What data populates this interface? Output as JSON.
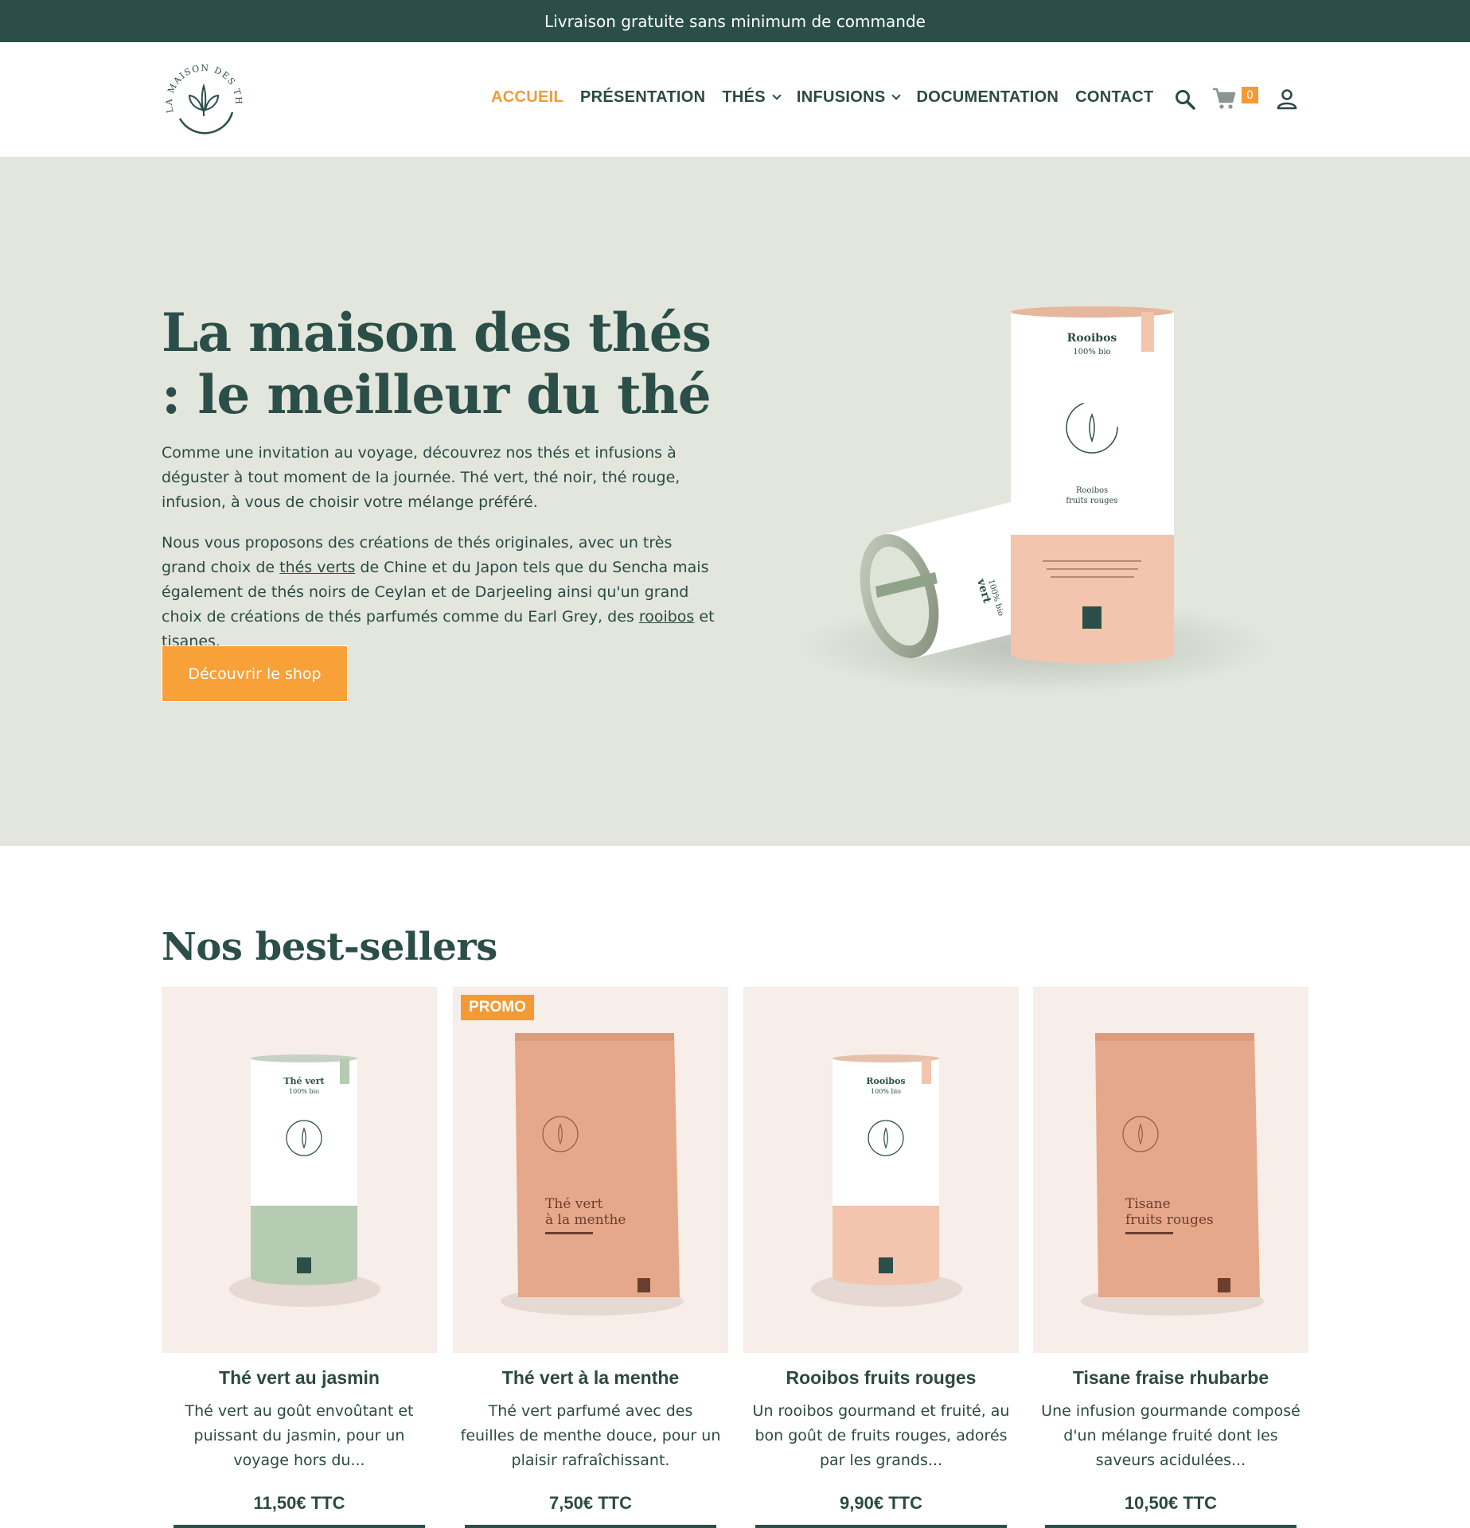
{
  "topbar": {
    "text": "Livraison gratuite sans minimum de commande"
  },
  "header": {
    "logo_text": "LA MAISON DES THÉS",
    "nav": [
      {
        "label": "ACCUEIL",
        "active": true
      },
      {
        "label": "PRÉSENTATION"
      },
      {
        "label": "THÉS",
        "has_dropdown": true
      },
      {
        "label": "INFUSIONS",
        "has_dropdown": true
      },
      {
        "label": "DOCUMENTATION"
      },
      {
        "label": "CONTACT"
      }
    ],
    "cart_count": "0",
    "icons": [
      "search-icon",
      "cart-icon",
      "user-icon"
    ]
  },
  "hero": {
    "title": "La maison des thés : le meilleur du thé",
    "paragraph1": "Comme une invitation au voyage, découvrez nos thés et infusions à déguster à tout moment de la journée. Thé vert, thé noir, thé rouge, infusion, à vous de choisir votre mélange préféré.",
    "paragraph2": {
      "before_link1": "Nous vous proposons des créations de thés originales, avec un très grand choix de ",
      "link1": "thés verts",
      "between": " de Chine et du Japon tels que du Sencha mais également de thés noirs de Ceylan et de Darjeeling ainsi qu'un grand choix de créations de thés parfumés comme du Earl Grey, des ",
      "link2": "rooibos",
      "and": " et ",
      "link3": "tisanes",
      "end": "."
    },
    "cta": "Découvrir le shop",
    "tin_label_title": "Rooibos",
    "tin_label_sub": "100% bio",
    "tin_label_flavor1": "Rooibos",
    "tin_label_flavor2": "fruits rouges",
    "lying_tin_label": "vert",
    "lying_tin_sub": "100% bio"
  },
  "bestsellers": {
    "title": "Nos best-sellers",
    "promo_label": "PROMO",
    "products": [
      {
        "name": "Thé vert au jasmin",
        "desc": "Thé vert au goût envoûtant et puissant du jasmin, pour un voyage hors du...",
        "price": "11,50€ TTC",
        "pack_title": "Thé vert",
        "pack_sub": "100% bio"
      },
      {
        "name": "Thé vert à la menthe",
        "desc": "Thé vert parfumé avec des feuilles de menthe douce, pour un plaisir rafraîchissant.",
        "price": "7,50€ TTC",
        "pack_title1": "Thé vert",
        "pack_title2": "à la menthe",
        "promo": true
      },
      {
        "name": "Rooibos fruits rouges",
        "desc": "Un rooibos gourmand et fruité, au bon goût de fruits rouges, adorés par les grands...",
        "price": "9,90€ TTC",
        "pack_title": "Rooibos",
        "pack_sub": "100% bio"
      },
      {
        "name": "Tisane fraise rhubarbe",
        "desc": "Une infusion gourmande composé d'un mélange fruité dont les saveurs acidulées...",
        "price": "10,50€ TTC",
        "pack_title1": "Tisane",
        "pack_title2": "fruits rouges"
      }
    ]
  },
  "colors": {
    "brand": "#2b4f48",
    "accent": "#f39a37",
    "hero_bg": "#e2e6dc",
    "card_bg": "#f7ede9",
    "peach": "#f3c5ae"
  }
}
